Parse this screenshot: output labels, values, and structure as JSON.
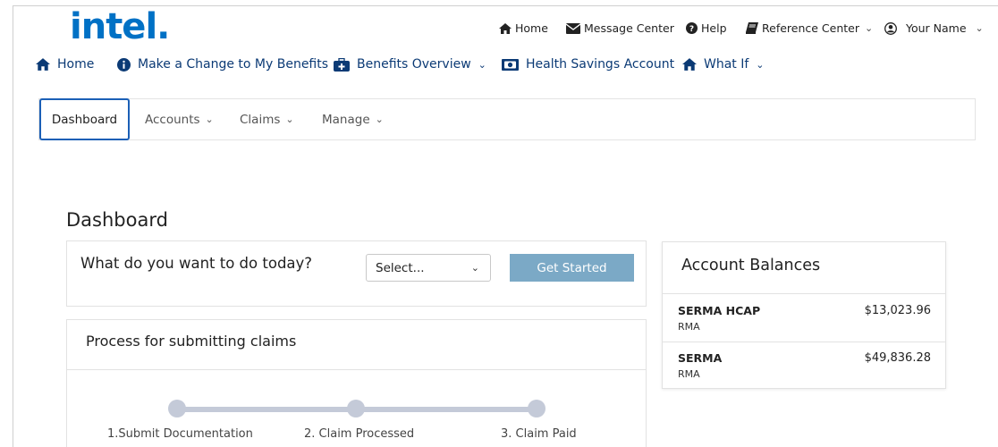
{
  "brand": {
    "logo_text": "intel",
    "color": "#0071c5"
  },
  "utility_nav": {
    "home": "Home",
    "message_center": "Message Center",
    "help": "Help",
    "reference_center": "Reference Center",
    "user_name": "Your Name"
  },
  "main_nav": [
    {
      "label": "Home",
      "icon": "home-icon"
    },
    {
      "label": "Make a Change to My Benefits",
      "icon": "info-icon"
    },
    {
      "label": "Benefits Overview",
      "icon": "medical-bag-icon"
    },
    {
      "label": "Health Savings Account",
      "icon": "money-icon"
    },
    {
      "label": "What If",
      "icon": "home-icon"
    }
  ],
  "sub_nav": {
    "dashboard": "Dashboard",
    "accounts": "Accounts",
    "claims": "Claims",
    "manage": "Manage"
  },
  "page": {
    "title": "Dashboard"
  },
  "todo": {
    "question": "What do you want to do today?",
    "select_value": "Select...",
    "button": "Get Started"
  },
  "process": {
    "title": "Process for submitting claims",
    "steps": [
      "1.Submit Documentation",
      "2. Claim Processed",
      "3. Claim Paid"
    ]
  },
  "balances": {
    "title": "Account Balances",
    "rows": [
      {
        "name": "SERMA HCAP",
        "sub": "RMA",
        "amount": "$13,023.96"
      },
      {
        "name": "SERMA",
        "sub": "RMA",
        "amount": "$49,836.28"
      }
    ]
  },
  "colors": {
    "nav_text": "#0b3a75",
    "button": "#7ba9c6",
    "active_tab_border": "#1b5fb6",
    "step": "#c4cad8"
  }
}
